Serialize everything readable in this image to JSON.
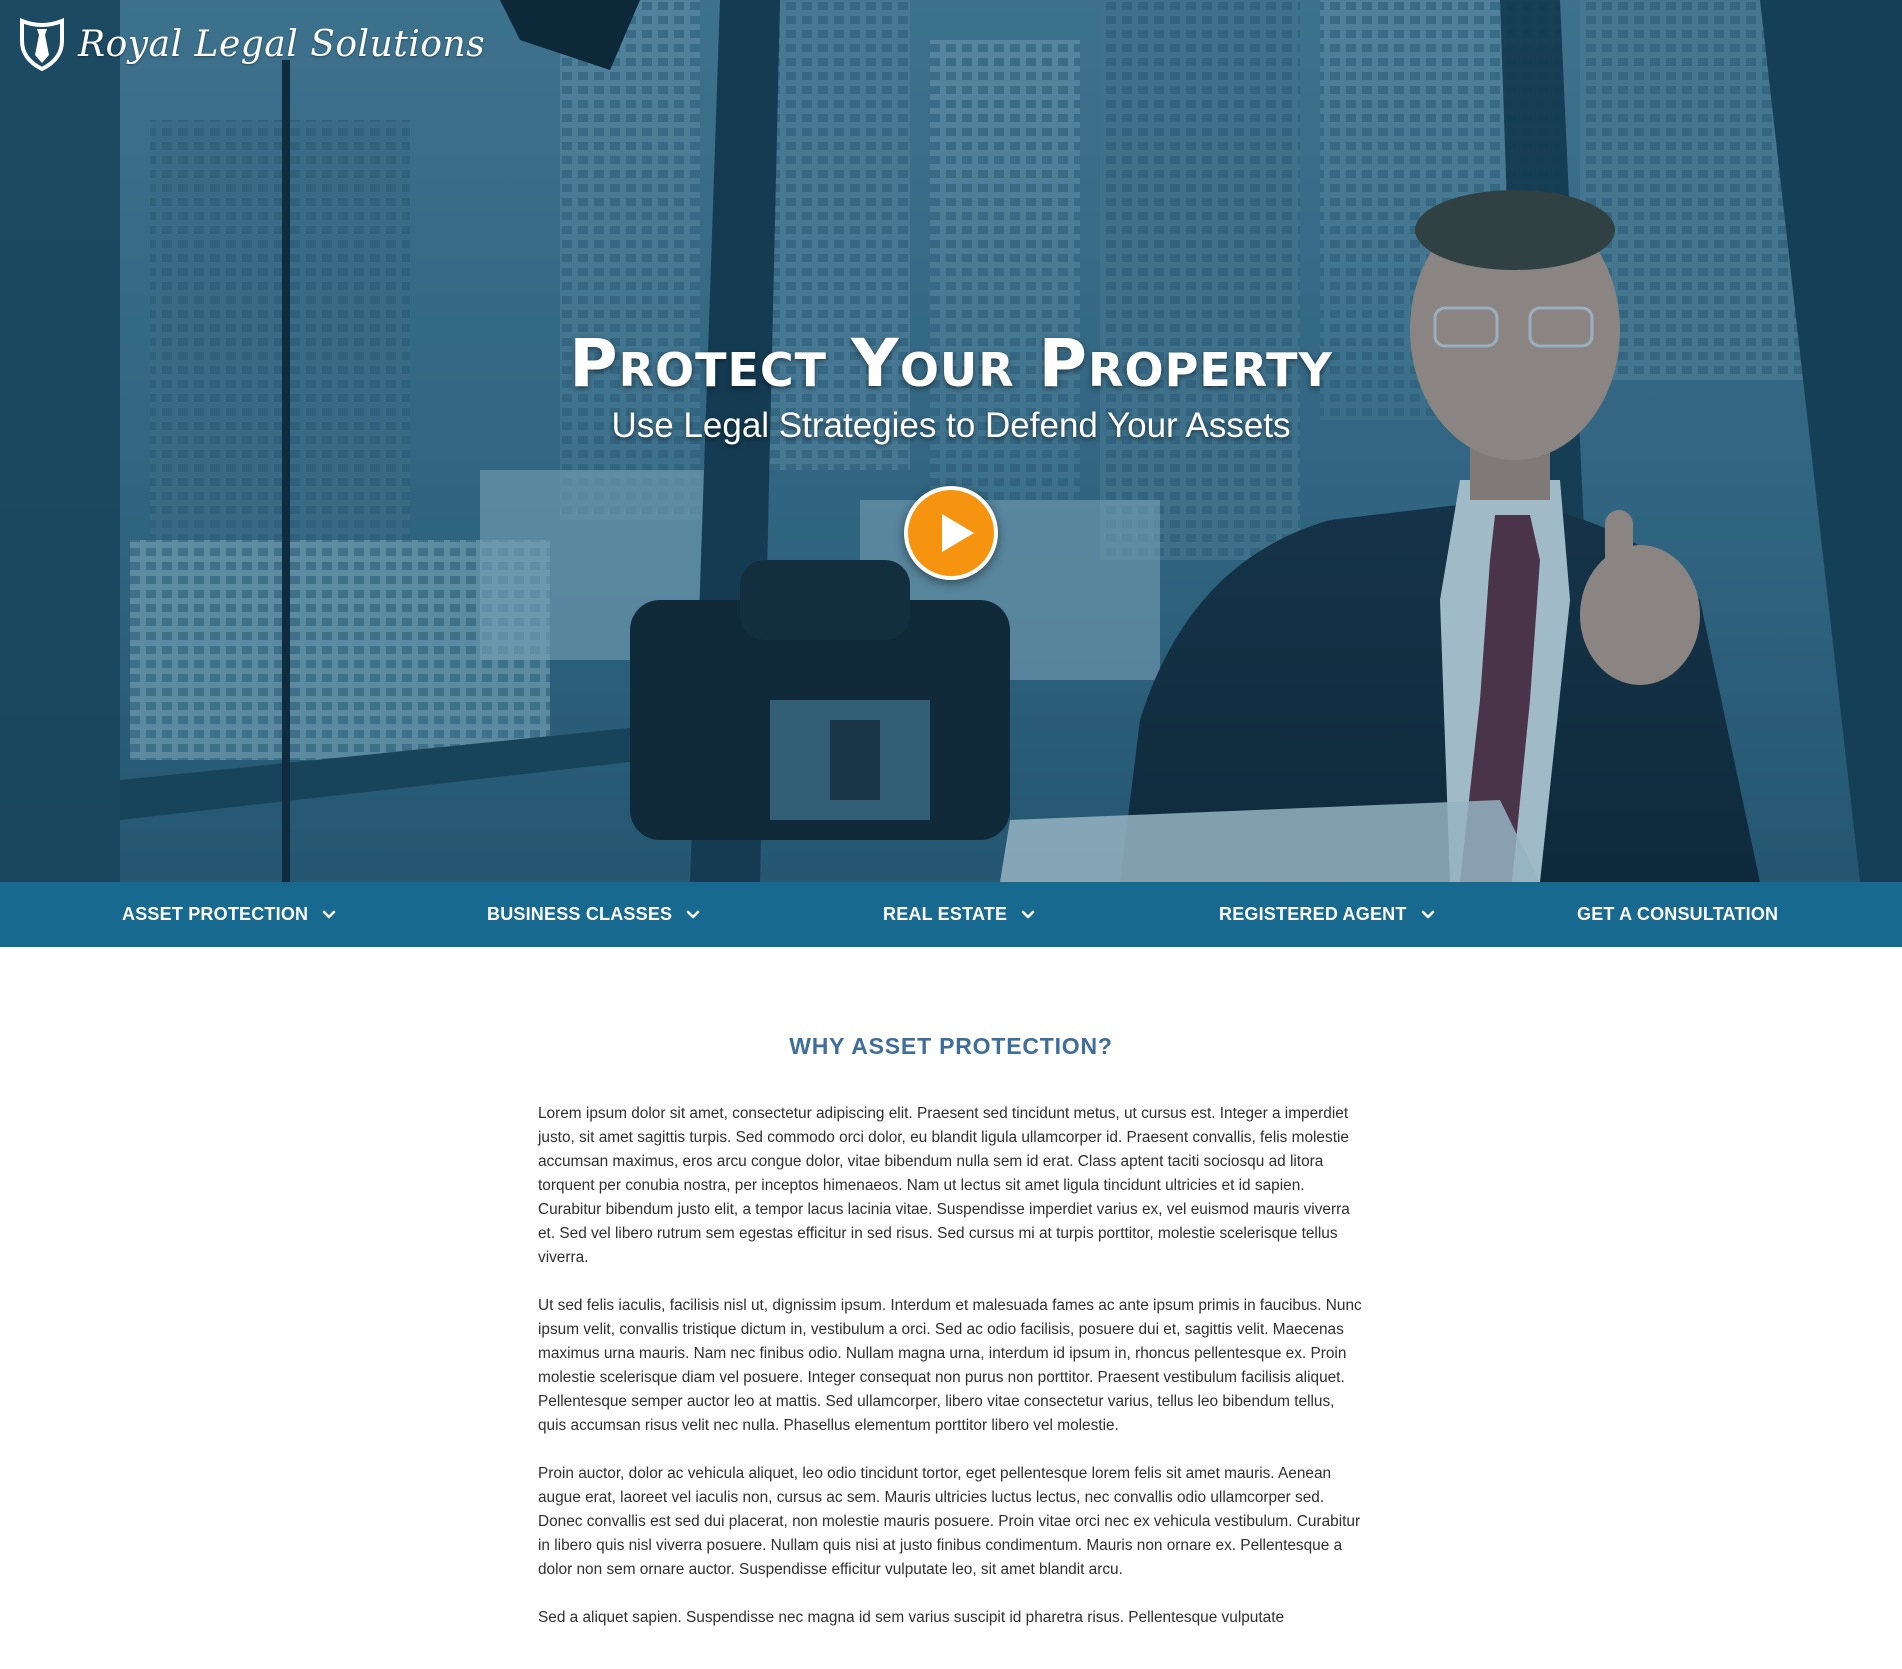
{
  "brand": {
    "name": "Royal Legal Solutions",
    "logo_icon": "shield-tie-icon"
  },
  "hero": {
    "title": "Protect Your Property",
    "subtitle": "Use Legal Strategies to Defend Your Assets",
    "play_icon": "play-icon",
    "play_color": "#f7940f"
  },
  "nav": {
    "items": [
      {
        "label": "ASSET PROTECTION",
        "has_dropdown": true
      },
      {
        "label": "BUSINESS CLASSES",
        "has_dropdown": true
      },
      {
        "label": "REAL ESTATE",
        "has_dropdown": true
      },
      {
        "label": "REGISTERED AGENT",
        "has_dropdown": true
      },
      {
        "label": "GET A CONSULTATION",
        "has_dropdown": false
      }
    ],
    "background": "#17698f"
  },
  "main": {
    "heading": "WHY ASSET PROTECTION?",
    "heading_color": "#3f6e9b",
    "paragraphs": [
      "Lorem ipsum dolor sit amet, consectetur adipiscing elit. Praesent sed tincidunt metus, ut cursus est. Integer a imperdiet justo, sit amet sagittis turpis. Sed commodo orci dolor, eu blandit ligula ullamcorper id. Praesent convallis, felis molestie accumsan maximus, eros arcu congue dolor, vitae bibendum nulla sem id erat. Class aptent taciti sociosqu ad litora torquent per conubia nostra, per inceptos himenaeos. Nam ut lectus sit amet ligula tincidunt ultricies et id sapien. Curabitur bibendum justo elit, a tempor lacus lacinia vitae. Suspendisse imperdiet varius ex, vel euismod mauris viverra et. Sed vel libero rutrum sem egestas efficitur in sed risus. Sed cursus mi at turpis porttitor, molestie scelerisque tellus viverra.",
      "Ut sed felis iaculis, facilisis nisl ut, dignissim ipsum. Interdum et malesuada fames ac ante ipsum primis in faucibus. Nunc ipsum velit, convallis tristique dictum in, vestibulum a orci. Sed ac odio facilisis, posuere dui et, sagittis velit. Maecenas maximus urna mauris. Nam nec finibus odio. Nullam magna urna, interdum id ipsum in, rhoncus pellentesque ex. Proin molestie scelerisque diam vel posuere. Integer consequat non purus non porttitor. Praesent vestibulum facilisis aliquet. Pellentesque semper auctor leo at mattis. Sed ullamcorper, libero vitae consectetur varius, tellus leo bibendum tellus, quis accumsan risus velit nec nulla. Phasellus elementum porttitor libero vel molestie.",
      "Proin auctor, dolor ac vehicula aliquet, leo odio tincidunt tortor, eget pellentesque lorem felis sit amet mauris. Aenean augue erat, laoreet vel iaculis non, cursus ac sem. Mauris ultricies luctus lectus, nec convallis odio ullamcorper sed. Donec convallis est sed dui placerat, non molestie mauris posuere. Proin vitae orci nec ex vehicula vestibulum. Curabitur in libero quis nisl viverra posuere. Nullam quis nisi at justo finibus condimentum. Mauris non ornare ex. Pellentesque a dolor non sem ornare auctor. Suspendisse efficitur vulputate leo, sit amet blandit arcu.",
      "Sed a aliquet sapien. Suspendisse nec magna id sem varius suscipit id pharetra risus. Pellentesque vulputate"
    ]
  }
}
